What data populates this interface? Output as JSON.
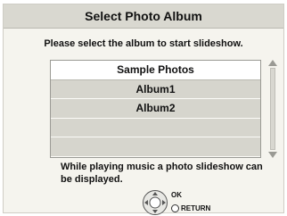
{
  "dialog": {
    "title": "Select Photo Album",
    "instruction": "Please select the album to start slideshow.",
    "albums": [
      {
        "label": "Sample Photos",
        "selected": true
      },
      {
        "label": "Album1",
        "selected": false
      },
      {
        "label": "Album2",
        "selected": false
      },
      {
        "label": "",
        "selected": false
      },
      {
        "label": "",
        "selected": false
      }
    ],
    "note": "While playing music a photo slideshow can be displayed.",
    "keys": {
      "ok_label": "OK",
      "return_label": "RETURN"
    },
    "icons": {
      "nav": "directional-pad-icon",
      "return": "return-button-icon",
      "scroll_up": "scroll-up-arrow-icon",
      "scroll_down": "scroll-down-arrow-icon"
    },
    "colors": {
      "title_bar": "#d9d8d0",
      "panel": "#f5f4ee",
      "list_row": "#d6d5cd",
      "selected_row": "#ffffff"
    }
  }
}
